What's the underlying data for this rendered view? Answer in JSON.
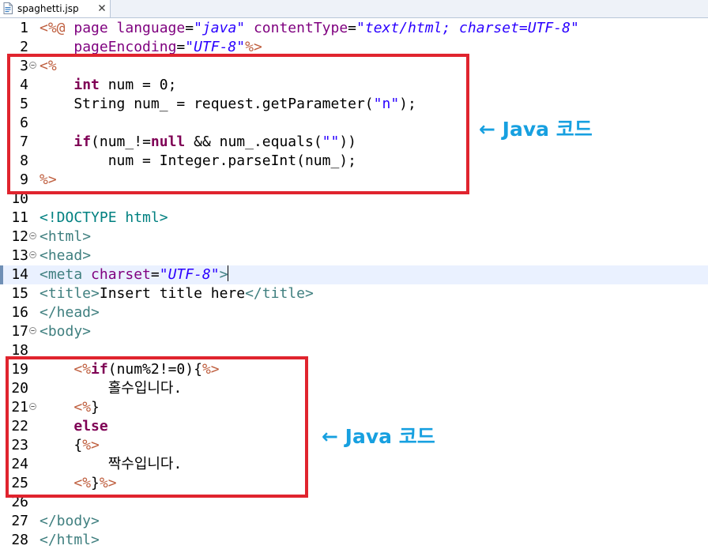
{
  "tab": {
    "title": "spaghetti.jsp",
    "close_icon": "close-icon",
    "file_icon": "jsp-file-icon"
  },
  "editor": {
    "current_line": 14,
    "lines": [
      {
        "n": "1",
        "fold": false
      },
      {
        "n": "2",
        "fold": false
      },
      {
        "n": "3",
        "fold": true
      },
      {
        "n": "4",
        "fold": false
      },
      {
        "n": "5",
        "fold": false
      },
      {
        "n": "6",
        "fold": false
      },
      {
        "n": "7",
        "fold": false
      },
      {
        "n": "8",
        "fold": false
      },
      {
        "n": "9",
        "fold": false
      },
      {
        "n": "10",
        "fold": false
      },
      {
        "n": "11",
        "fold": false
      },
      {
        "n": "12",
        "fold": true
      },
      {
        "n": "13",
        "fold": true
      },
      {
        "n": "14",
        "fold": false
      },
      {
        "n": "15",
        "fold": false
      },
      {
        "n": "16",
        "fold": false
      },
      {
        "n": "17",
        "fold": true
      },
      {
        "n": "18",
        "fold": false
      },
      {
        "n": "19",
        "fold": false
      },
      {
        "n": "20",
        "fold": false
      },
      {
        "n": "21",
        "fold": true
      },
      {
        "n": "22",
        "fold": false
      },
      {
        "n": "23",
        "fold": false
      },
      {
        "n": "24",
        "fold": false
      },
      {
        "n": "25",
        "fold": false
      },
      {
        "n": "26",
        "fold": false
      },
      {
        "n": "27",
        "fold": false
      },
      {
        "n": "28",
        "fold": false
      }
    ],
    "code": {
      "l1_open": "<%@",
      "l1_page": " page",
      "l1_language": " language",
      "l1_eq1": "=",
      "l1_java": "\"java\"",
      "l1_contentType": " contentType",
      "l1_eq2": "=",
      "l1_texthtml": "\"text/html; charset=UTF-8\"",
      "l2_indent": "    ",
      "l2_pageEncoding": "pageEncoding",
      "l2_eq": "=",
      "l2_utf8": "\"UTF-8\"",
      "l2_close": "%>",
      "l3_open": "<%",
      "l4_indent": "    ",
      "l4_int": "int",
      "l4_rest": " num = 0;",
      "l5_text_a": "    String num_ = request.getParameter(",
      "l5_str": "\"n\"",
      "l5_text_b": ");",
      "l7_indent": "    ",
      "l7_if": "if",
      "l7_text_a": "(num_!=",
      "l7_null": "null",
      "l7_text_b": " && num_.equals(",
      "l7_str": "\"\"",
      "l7_text_c": "))",
      "l8_text": "        num = Integer.parseInt(num_);",
      "l9_close": "%>",
      "l11_doctype": "<!DOCTYPE html>",
      "l12_lt": "<",
      "l12_name": "html",
      "l12_gt": ">",
      "l13_lt": "<",
      "l13_name": "head",
      "l13_gt": ">",
      "l14_lt": "<",
      "l14_name": "meta",
      "l14_attr": " charset",
      "l14_eq": "=",
      "l14_val": "\"UTF-8\"",
      "l14_gt": ">",
      "l15_open": "<title>",
      "l15_text": "Insert title here",
      "l15_close": "</title>",
      "l16_tag": "</head>",
      "l17_tag": "<body>",
      "l19_indent": "    ",
      "l19_open": "<%",
      "l19_if": "if",
      "l19_cond": "(num%2!=0){",
      "l19_close": "%>",
      "l20_text": "        홀수입니다.",
      "l21_indent": "    ",
      "l21_open": "<%",
      "l21_brace": "}",
      "l22_indent": "    ",
      "l22_else": "else",
      "l23_text": "    {",
      "l23_close": "%>",
      "l24_text": "        짝수입니다.",
      "l25_indent": "    ",
      "l25_open": "<%",
      "l25_brace": "}",
      "l25_close": "%>",
      "l27_tag": "</body>",
      "l28_tag": "</html>"
    }
  },
  "annotations": {
    "top": "← Java 코드",
    "bottom": "← Java 코드",
    "box_color": "#e0242e",
    "text_color": "#17a0e0"
  }
}
